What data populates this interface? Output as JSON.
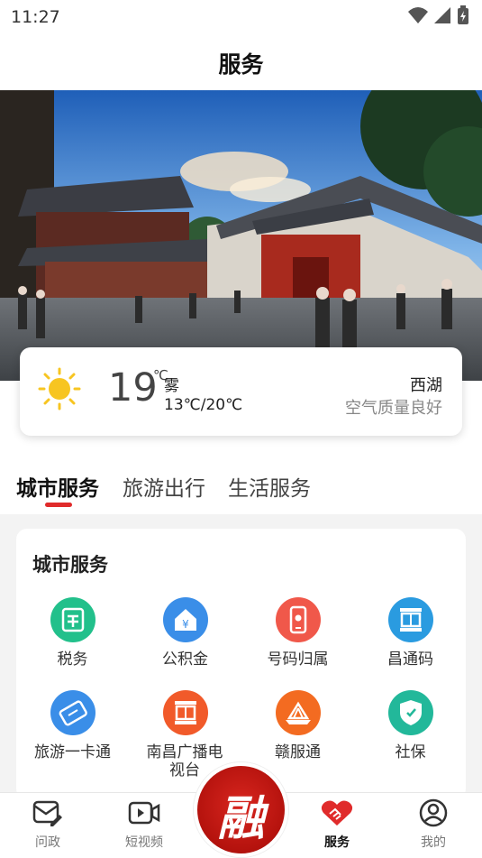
{
  "status_bar": {
    "time": "11:27"
  },
  "header": {
    "title": "服务"
  },
  "weather": {
    "icon": "sun-icon",
    "temperature": "19",
    "unit": "℃",
    "condition": "雾",
    "range": "13℃/20℃",
    "city": "西湖",
    "air_quality": "空气质量良好"
  },
  "tabs": [
    {
      "label": "城市服务",
      "active": true
    },
    {
      "label": "旅游出行",
      "active": false
    },
    {
      "label": "生活服务",
      "active": false
    }
  ],
  "section": {
    "title": "城市服务",
    "items": [
      {
        "label": "税务",
        "icon": "tax-icon",
        "color": "#22c08b"
      },
      {
        "label": "公积金",
        "icon": "housing-fund-icon",
        "color": "#3a8ee8"
      },
      {
        "label": "号码归属",
        "icon": "phone-number-icon",
        "color": "#f0584a"
      },
      {
        "label": "昌通码",
        "icon": "changtong-code-icon",
        "color": "#2a9be0"
      },
      {
        "label": "旅游一卡通",
        "icon": "travel-card-icon",
        "color": "#3a8ee8"
      },
      {
        "label": "南昌广播电视台",
        "icon": "tv-station-icon",
        "color": "#f15a2a"
      },
      {
        "label": "赣服通",
        "icon": "ganfutong-icon",
        "color": "#f36b21"
      },
      {
        "label": "社保",
        "icon": "social-security-icon",
        "color": "#22b89a"
      }
    ]
  },
  "bottom_nav": {
    "items": [
      {
        "label": "问政",
        "icon": "message-edit-icon"
      },
      {
        "label": "短视频",
        "icon": "video-icon"
      },
      {
        "label": "服务",
        "icon": "handshake-heart-icon",
        "active": true
      },
      {
        "label": "我的",
        "icon": "user-icon"
      }
    ],
    "center_logo": "融"
  },
  "colors": {
    "accent": "#e02b2b",
    "sun": "#f7c521"
  }
}
